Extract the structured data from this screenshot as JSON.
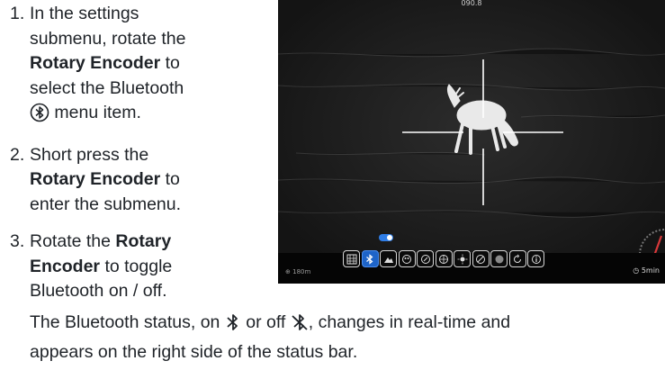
{
  "instructions": {
    "steps": [
      {
        "number": "1.",
        "lines": [
          "In the settings",
          "submenu, rotate the",
          "Rotary Encoder",
          " to",
          "select the Bluetooth",
          " menu item."
        ]
      },
      {
        "number": "2.",
        "lines": [
          "Short press the",
          "Rotary Encoder",
          " to",
          "enter the submenu."
        ]
      },
      {
        "number": "3.",
        "lines": [
          "Rotate the ",
          "Rotary",
          "Encoder",
          " to toggle",
          "Bluetooth on / off."
        ]
      }
    ],
    "status_note": {
      "part1": "The Bluetooth status, on ",
      "part2": " or off ",
      "part3": ", changes in real-time and",
      "line2": "appears on the right side of the status bar."
    }
  },
  "scope_screen": {
    "heading_readout": "090.8",
    "range_readout": "180m",
    "timer_readout": "5min",
    "selected_menu": "bluetooth",
    "menu_icons": [
      "image-grid-icon",
      "bluetooth-icon",
      "mountain-icon",
      "palette-icon",
      "compass-icon",
      "crosshair-icon",
      "sun-icon",
      "slash-icon",
      "color-icon",
      "refresh-icon",
      "info-icon"
    ],
    "bluetooth_toggle": "on",
    "colors": {
      "accent": "#1e64c8",
      "reticle": "#ffffff",
      "background": "#1b1b1b"
    }
  }
}
